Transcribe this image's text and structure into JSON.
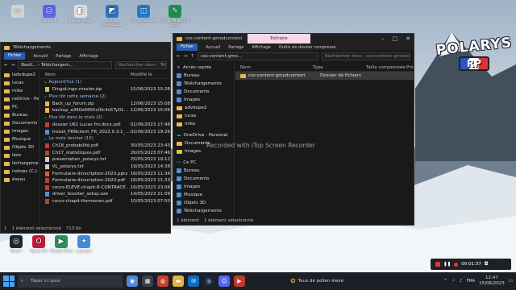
{
  "desktop": {
    "icons_top": [
      {
        "label": "",
        "color": "#d4d4d4",
        "glyph": "▭",
        "icon": "recycle-bin-icon"
      },
      {
        "label": "Discord",
        "color": "#5865f2",
        "glyph": "☺",
        "icon": "discord-icon"
      },
      {
        "label": "Boston Major",
        "color": "#e0e0e0",
        "glyph": "◧",
        "icon": "app-icon"
      },
      {
        "label": "Citrix Workspace",
        "color": "#2a72c3",
        "glyph": "◩",
        "icon": "citrix-icon"
      },
      {
        "label": "Citrix Explorer",
        "color": "#1c7cd5",
        "glyph": "◫",
        "icon": "app-icon"
      },
      {
        "label": "Citrix PRONOTE 2023",
        "color": "#1b8f4a",
        "glyph": "✎",
        "icon": "pronote-icon"
      }
    ],
    "icons_bottom": [
      {
        "label": "Steam",
        "color": "#1b2838",
        "glyph": "◎",
        "icon": "steam-icon"
      },
      {
        "label": "Opera GX",
        "color": "#c01a3a",
        "glyph": "O",
        "icon": "opera-icon"
      },
      {
        "label": "Google Meet",
        "color": "#2d8f5a",
        "glyph": "▶",
        "icon": "meet-icon"
      },
      {
        "label": "capsules",
        "color": "#3f8bdc",
        "glyph": "✦",
        "icon": "capsule-icon"
      }
    ],
    "logo_text": "POLARYS",
    "logo_sub": "RP",
    "watermark": "Recorded with iTop Screen Recorder"
  },
  "win1": {
    "title": "Téléchargements",
    "tabs": [
      "Fichier",
      "Accueil",
      "Partage",
      "Affichage"
    ],
    "path": "Téléchargem...",
    "path_prefix": "Bastl...",
    "search_placeholder": "Rechercher dans : Téléchargements",
    "col_name": "Nom",
    "col_modified": "Modifié le",
    "nav_items": [
      "ladvdupe2",
      "lucas",
      "mike",
      "neDrive - Personal",
      "PC",
      "Bureau",
      "Documents",
      "Images",
      "Musique",
      "Objets 3D",
      "léos",
      "léchargements",
      "indows (C:)",
      "éseau"
    ],
    "groups": [
      {
        "header": "Aujourd'hui (1)",
        "files": [
          {
            "name": "DingoLingo-master.zip",
            "date": "15/06/2023 10:26",
            "type": "zip"
          }
        ]
      },
      {
        "header": "Plus tôt cette semaine (2)",
        "files": [
          {
            "name": "Back_up_forum.zip",
            "date": "12/06/2023 15:08",
            "type": "zip"
          },
          {
            "name": "backup_a360e6665c0fc4d1TyDLLeaKnG...",
            "date": "12/06/2023 15:06",
            "type": "zip"
          }
        ]
      },
      {
        "header": "Plus tôt dans le mois (2)",
        "files": [
          {
            "name": "dossier U61 Lucas fro.docx.pdf",
            "date": "01/06/2023 17:48",
            "type": "pdf"
          },
          {
            "name": "Install_PRNclient_FR_2022.0.3.1_win64.exe",
            "date": "02/06/2023 19:26",
            "type": "exe"
          }
        ]
      },
      {
        "header": "Le mois dernier (15)",
        "files": [
          {
            "name": "Ch18_probabilité.pdf",
            "date": "30/05/2023 23:43",
            "type": "pdf"
          },
          {
            "name": "Ch17_statistiques.pdf",
            "date": "26/05/2023 07:46",
            "type": "pdf"
          },
          {
            "name": "presentation_polarys.txt",
            "date": "25/05/2023 19:12",
            "type": "txt"
          },
          {
            "name": "VL_polarys.txt",
            "date": "19/05/2023 14:38",
            "type": "txt"
          },
          {
            "name": "Formulaire-dinscription-2023.pptx",
            "date": "16/05/2023 11:34",
            "type": "pptx"
          },
          {
            "name": "Formulaire-dinscription-2023.pdf",
            "date": "16/05/2023 11:33",
            "type": "pdf"
          },
          {
            "name": "cours-ELEVE-chapit-8-CONTRACEPTION-...",
            "date": "16/05/2023 23:06",
            "type": "pdf"
          },
          {
            "name": "driver_booster_setup.exe",
            "date": "14/05/2023 21:09",
            "type": "exe"
          },
          {
            "name": "cours-chapit-Hormones.pdf",
            "date": "10/05/2023 07:50",
            "type": "pdf"
          }
        ]
      }
    ],
    "status": [
      "1",
      "1 élément sélectionné",
      "713 Ko"
    ]
  },
  "win2": {
    "title": "css-content-gmodcontent",
    "context_tab": "Extraire",
    "tabs": [
      "Fichier",
      "Accueil",
      "Partage",
      "Affichage",
      "Outils de dossier compressé"
    ],
    "path": "css-content-gmo...",
    "search_placeholder": "Rechercher dans : css-content-gmodcontent.zip",
    "columns": [
      "Nom",
      "Type",
      "Taille compressée",
      "Pro"
    ],
    "nav_items": [
      {
        "label": "Accès rapide",
        "kind": "star"
      },
      {
        "label": "Bureau",
        "kind": "blue"
      },
      {
        "label": "Téléchargements",
        "kind": "blue"
      },
      {
        "label": "Documents",
        "kind": "blue"
      },
      {
        "label": "Images",
        "kind": "blue"
      },
      {
        "label": "advdupe2",
        "kind": "folder"
      },
      {
        "label": "lucas",
        "kind": "folder"
      },
      {
        "label": "mike",
        "kind": "folder"
      },
      {
        "label": "",
        "kind": "gap"
      },
      {
        "label": "OneDrive - Personal",
        "kind": "cloud"
      },
      {
        "label": "Documents",
        "kind": "folder"
      },
      {
        "label": "Images",
        "kind": "folder"
      },
      {
        "label": "",
        "kind": "gap"
      },
      {
        "label": "Ce PC",
        "kind": "pc"
      },
      {
        "label": "Bureau",
        "kind": "blue"
      },
      {
        "label": "Documents",
        "kind": "blue"
      },
      {
        "label": "Images",
        "kind": "blue"
      },
      {
        "label": "Musique",
        "kind": "blue"
      },
      {
        "label": "Objets 3D",
        "kind": "blue"
      },
      {
        "label": "Téléchargements",
        "kind": "blue"
      }
    ],
    "files": [
      {
        "name": "css-content-gmodcontent",
        "type": "Dossier de fichiers"
      }
    ],
    "status": [
      "1 élément",
      "1 élément sélectionné"
    ]
  },
  "taskbar": {
    "search_placeholder": "Taper ici pour",
    "weather": "Taux de pollen élevé",
    "lang": "FRA",
    "time": "12:47",
    "date": "15/06/2023",
    "apps": [
      {
        "glyph": "◉",
        "color": "#4b8cde",
        "icon": "task-view-icon"
      },
      {
        "glyph": "▦",
        "color": "#3a3f48",
        "icon": "widgets-icon"
      },
      {
        "glyph": "◍",
        "color": "#c7402d",
        "icon": "chrome-icon"
      },
      {
        "glyph": "▬",
        "color": "#e3b341",
        "icon": "explorer-icon"
      },
      {
        "glyph": "✉",
        "color": "#0f6cbd",
        "icon": "mail-icon"
      },
      {
        "glyph": "◎",
        "color": "#1b2838",
        "icon": "steam-icon"
      },
      {
        "glyph": "☺",
        "color": "#5865f2",
        "icon": "discord-icon"
      },
      {
        "glyph": "▶",
        "color": "#c0392b",
        "icon": "media-icon"
      }
    ]
  },
  "recorder": {
    "time": "00:01:37"
  }
}
